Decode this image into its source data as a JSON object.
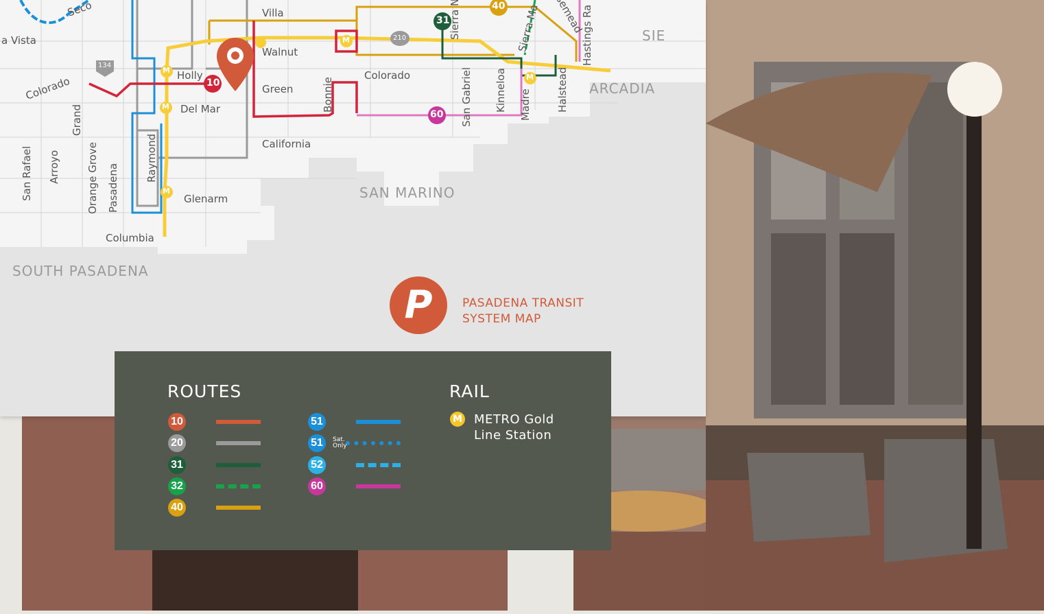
{
  "map": {
    "streets": {
      "seco": "Seco",
      "villa": "Villa",
      "walnut": "Walnut",
      "holly": "Holly",
      "colorado_west": "Colorado",
      "colorado_east": "Colorado",
      "green": "Green",
      "del_mar": "Del Mar",
      "california": "California",
      "glenarm": "Glenarm",
      "columbia": "Columbia",
      "grand": "Grand",
      "san_rafael": "San Rafael",
      "arroyo": "Arroyo",
      "orange_grove": "Orange Grove",
      "pasadena": "Pasadena",
      "raymond": "Raymond",
      "bonnie": "Bonnie",
      "san_gabriel": "San Gabriel",
      "kinneloa": "Kinneloa",
      "madre": "Madre",
      "halstead": "Halstead",
      "hastings": "Hastings Ra",
      "sierra_madre": "Sierra Ma",
      "sierra_north": "Sierra N",
      "rosemead": "semead",
      "vista": "a Vista"
    },
    "highways": {
      "i134": "134",
      "i210": "210"
    },
    "cities": {
      "south_pasadena": "SOUTH PASADENA",
      "san_marino": "SAN MARINO",
      "arcadia": "ARCADIA",
      "sierra_edge": "SIE"
    },
    "route_markers": {
      "r10": "10",
      "r31": "31",
      "r40": "40",
      "r60": "60"
    },
    "metro_symbol": "M"
  },
  "brand": {
    "logo_letter": "P",
    "title_line1": "PASADENA TRANSIT",
    "title_line2": "SYSTEM MAP"
  },
  "legend": {
    "routes_heading": "ROUTES",
    "rail_heading": "RAIL",
    "routes": [
      {
        "number": "10",
        "color": "#d05a3a",
        "style": "solid"
      },
      {
        "number": "20",
        "color": "#9a9a9a",
        "style": "solid"
      },
      {
        "number": "31",
        "color": "#1f5e3a",
        "style": "solid"
      },
      {
        "number": "32",
        "color": "#16a34a",
        "style": "dashed"
      },
      {
        "number": "40",
        "color": "#d9a010",
        "style": "solid"
      },
      {
        "number": "51",
        "color": "#1b8fd8",
        "style": "solid"
      },
      {
        "number": "51",
        "color": "#1b8fd8",
        "style": "dotted",
        "note_line1": "Sat.",
        "note_line2": "Only"
      },
      {
        "number": "52",
        "color": "#2bb0e8",
        "style": "dashed"
      },
      {
        "number": "60",
        "color": "#c8389c",
        "style": "solid"
      }
    ],
    "rail": {
      "symbol": "M",
      "color": "#f4c628",
      "label_line1": "METRO Gold",
      "label_line2": "Line Station"
    }
  }
}
